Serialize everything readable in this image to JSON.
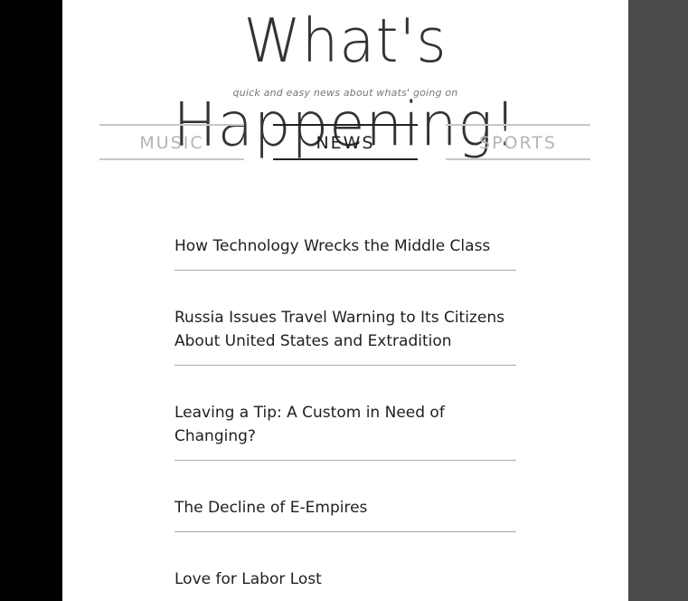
{
  "header": {
    "title": "What's Happening!",
    "tagline": "quick and easy news about whats' going on"
  },
  "nav": {
    "tabs": [
      {
        "label": "MUSIC",
        "active": false
      },
      {
        "label": "NEWS",
        "active": true
      },
      {
        "label": "SPORTS",
        "active": false
      }
    ]
  },
  "articles": [
    {
      "title": "How Technology Wrecks the Middle Class"
    },
    {
      "title": "Russia Issues Travel Warning to Its Citizens About United States and Extradition"
    },
    {
      "title": "Leaving a Tip: A Custom in Need of Changing?"
    },
    {
      "title": "The Decline of E-Empires"
    },
    {
      "title": "Love for Labor Lost"
    }
  ],
  "colors": {
    "background_left": "#000000",
    "background_right": "#4a4a4a",
    "page": "#ffffff",
    "active_tab": "#222222",
    "inactive_tab": "#b5b5b5"
  }
}
